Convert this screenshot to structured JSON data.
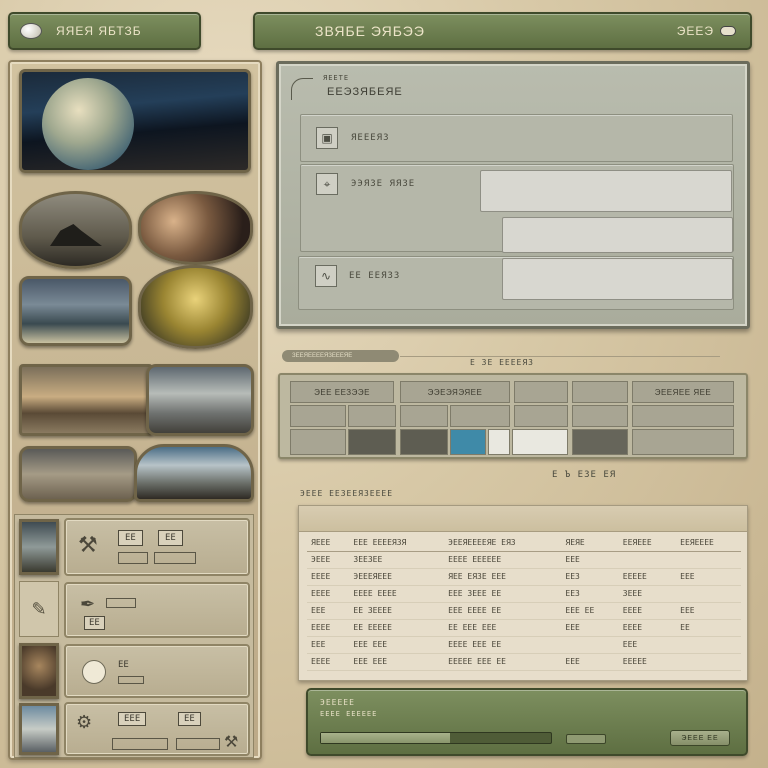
{
  "header_left": {
    "title": "ЯЯЕЯ ЯБТЗБ"
  },
  "header_right": {
    "title": "ЗВЯБЕ ЭЯБЭЭ",
    "right_label": "ЭЕЕЭ"
  },
  "form": {
    "title_small": "ЯЕЕТЕ",
    "title": "ЕЕЭЗЯБЕЯЕ",
    "rows": [
      {
        "icon": "document-icon",
        "label": "ЯЕЕЕЯЗ"
      },
      {
        "icon": "tool-icon",
        "label": "ЭЭЯЗЕ ЯЯЗЕ"
      },
      {
        "icon": "wave-icon",
        "label": "ЕЕ ЕЕЯЗЗ"
      }
    ]
  },
  "grid_panel": {
    "tab_label": "ЗЕЕЯЕЕЕЕЯЗЕЕЕЯЕ",
    "caption": "Е ЗЕ ЕЕЕЕЯЗ",
    "headers": [
      "ЭЕЕ ЕЕЗЭЭЕ",
      "ЭЭЕЭЯЭЯЕЕ",
      "ЭЕЕЯЕЕ ЯЕЕ"
    ]
  },
  "table_panel": {
    "caption": "Е Ъ ЕЗЕ ЕЯ",
    "section_label": "ЭЕЕЕ ЕЕЗЕЕЯЗЕЕЕЕ",
    "columns": [
      "ЯЕЕЕ",
      "ЕЕЕ ЕЕЕЕЯЗЯ",
      "ЭЕЕЯЕЕЕЕЯЕ ЕЯЗ",
      "ЯЕЯЕ",
      "ЕЕЯЕЕЕ",
      "ЕЕЯЕЕЕЕ"
    ],
    "rows": [
      [
        "ЭЕЕЕ",
        "ЗЕЕЗЕЕ",
        "ЕЕЕЕ ЕЕЕЕЕЕ",
        "ЕЕЕ",
        "",
        ""
      ],
      [
        "ЕЕЕЕ",
        "ЭЕЕЕЯЕЕЕ",
        "ЯЕЕ ЕЯЗЕ ЕЕЕ",
        "ЕЕЗ",
        "ЕЕЕЕЕ",
        "ЕЕЕ"
      ],
      [
        "ЕЕЕЕ",
        "ЕЕЕЕ ЕЕЕЕ",
        "ЕЕЕ ЗЕЕЕ ЕЕ",
        "ЕЕЗ",
        "ЗЕЕЕ",
        ""
      ],
      [
        "ЕЕЕ",
        "ЕЕ ЗЕЕЕЕ",
        "ЕЕЕ ЕЕЕЕ ЕЕ",
        "ЕЕЕ ЕЕ",
        "ЕЕЕЕ",
        "ЕЕЕ"
      ],
      [
        "ЕЕЕЕ",
        "ЕЕ ЕЕЕЕЕ",
        "ЕЕ ЕЕЕ ЕЕЕ",
        "ЕЕЕ",
        "ЕЕЕЕ",
        "ЕЕ"
      ],
      [
        "ЕЕЕ",
        "ЕЕЕ ЕЕЕ",
        "ЕЕЕЕ ЕЕЕ ЕЕ",
        "",
        "ЕЕЕ",
        ""
      ],
      [
        "ЕЕЕЕ",
        "ЕЕЕ ЕЕЕ",
        "ЕЕЕЕЕ ЕЕЕ ЕЕ",
        "ЕЕЕ",
        "ЕЕЕЕЕ",
        ""
      ]
    ]
  },
  "footer_panel": {
    "title": "ЭЕЕЕЕЕ",
    "subtitle": "ЕЕЕЕ ЕЕЕЕЕЕ",
    "button_label": "ЭЕЕЕ ЕЕ"
  },
  "cards": [
    {
      "label_a": "ЕЕ",
      "label_b": "ЕЕ"
    },
    {
      "label_a": "ЕЕ",
      "label_b": ""
    },
    {
      "label_a": "ЕЕ",
      "label_b": ""
    },
    {
      "label_a": "ЕЕЕ",
      "label_b": "ЕЕ"
    }
  ],
  "colors": {
    "accent_green": "#6b7c4e",
    "accent_blue": "#3f8aa8"
  }
}
